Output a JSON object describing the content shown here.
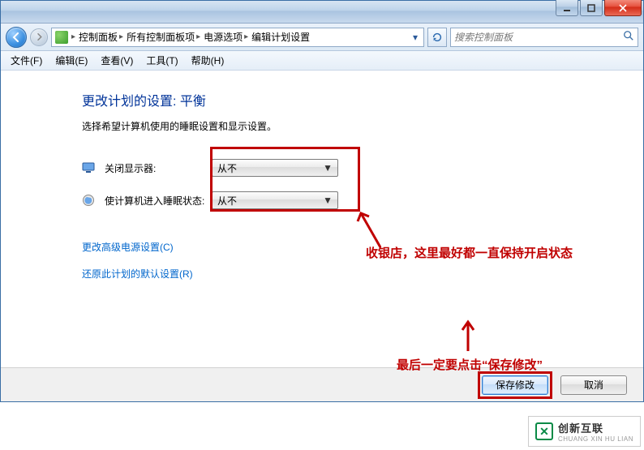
{
  "titlebar": {
    "min_tip": "Minimize",
    "max_tip": "Maximize",
    "close_tip": "Close"
  },
  "breadcrumb": {
    "items": [
      "控制面板",
      "所有控制面板项",
      "电源选项",
      "编辑计划设置"
    ]
  },
  "search": {
    "placeholder": "搜索控制面板"
  },
  "menu": {
    "file": "文件(F)",
    "edit": "编辑(E)",
    "view": "查看(V)",
    "tools": "工具(T)",
    "help": "帮助(H)"
  },
  "content": {
    "heading": "更改计划的设置: 平衡",
    "subtext": "选择希望计算机使用的睡眠设置和显示设置。",
    "row_display_label": "关闭显示器:",
    "row_display_value": "从不",
    "row_sleep_label": "使计算机进入睡眠状态:",
    "row_sleep_value": "从不",
    "link_advanced": "更改高级电源设置(C)",
    "link_restore": "还原此计划的默认设置(R)"
  },
  "annotations": {
    "note1": "收银店，这里最好都一直保持开启状态",
    "note2": "最后一定要点击“保存修改”"
  },
  "buttons": {
    "save": "保存修改",
    "cancel": "取消"
  },
  "watermark": {
    "cn": "创新互联",
    "en": "CHUANG XIN HU LIAN"
  }
}
